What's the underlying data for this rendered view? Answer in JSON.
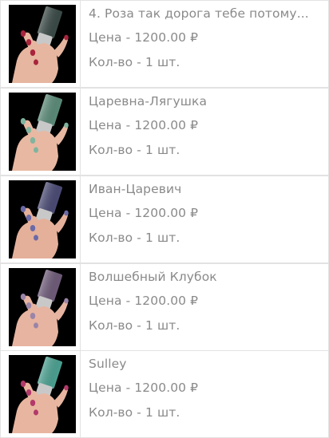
{
  "items": [
    {
      "name": "4. Роза так дорога тебе потому...",
      "price_text": "Цена - 1200.00 ₽",
      "qty_text": "Кол-во - 1 шт.",
      "bottle_color": "#3a4a46",
      "nail_color": "#a8243c",
      "skin_color": "#e6b6a0"
    },
    {
      "name": "Царевна-Лягушка",
      "price_text": "Цена - 1200.00 ₽",
      "qty_text": "Кол-во - 1 шт.",
      "bottle_color": "#5a8a78",
      "nail_color": "#7fb49e",
      "skin_color": "#e8b8a2"
    },
    {
      "name": "Иван-Царевич",
      "price_text": "Цена - 1200.00 ₽",
      "qty_text": "Кол-во - 1 шт.",
      "bottle_color": "#4a4a74",
      "nail_color": "#6a6aa8",
      "skin_color": "#e4b09a"
    },
    {
      "name": "Волшебный Клубок",
      "price_text": "Цена - 1200.00 ₽",
      "qty_text": "Кол-во - 1 шт.",
      "bottle_color": "#6e5a78",
      "nail_color": "#9a84a8",
      "skin_color": "#e6b4a0"
    },
    {
      "name": "Sulley",
      "price_text": "Цена - 1200.00 ₽",
      "qty_text": "Кол-во - 1 шт.",
      "bottle_color": "#4aa090",
      "nail_color": "#b23a6a",
      "skin_color": "#e8b6a0"
    }
  ]
}
